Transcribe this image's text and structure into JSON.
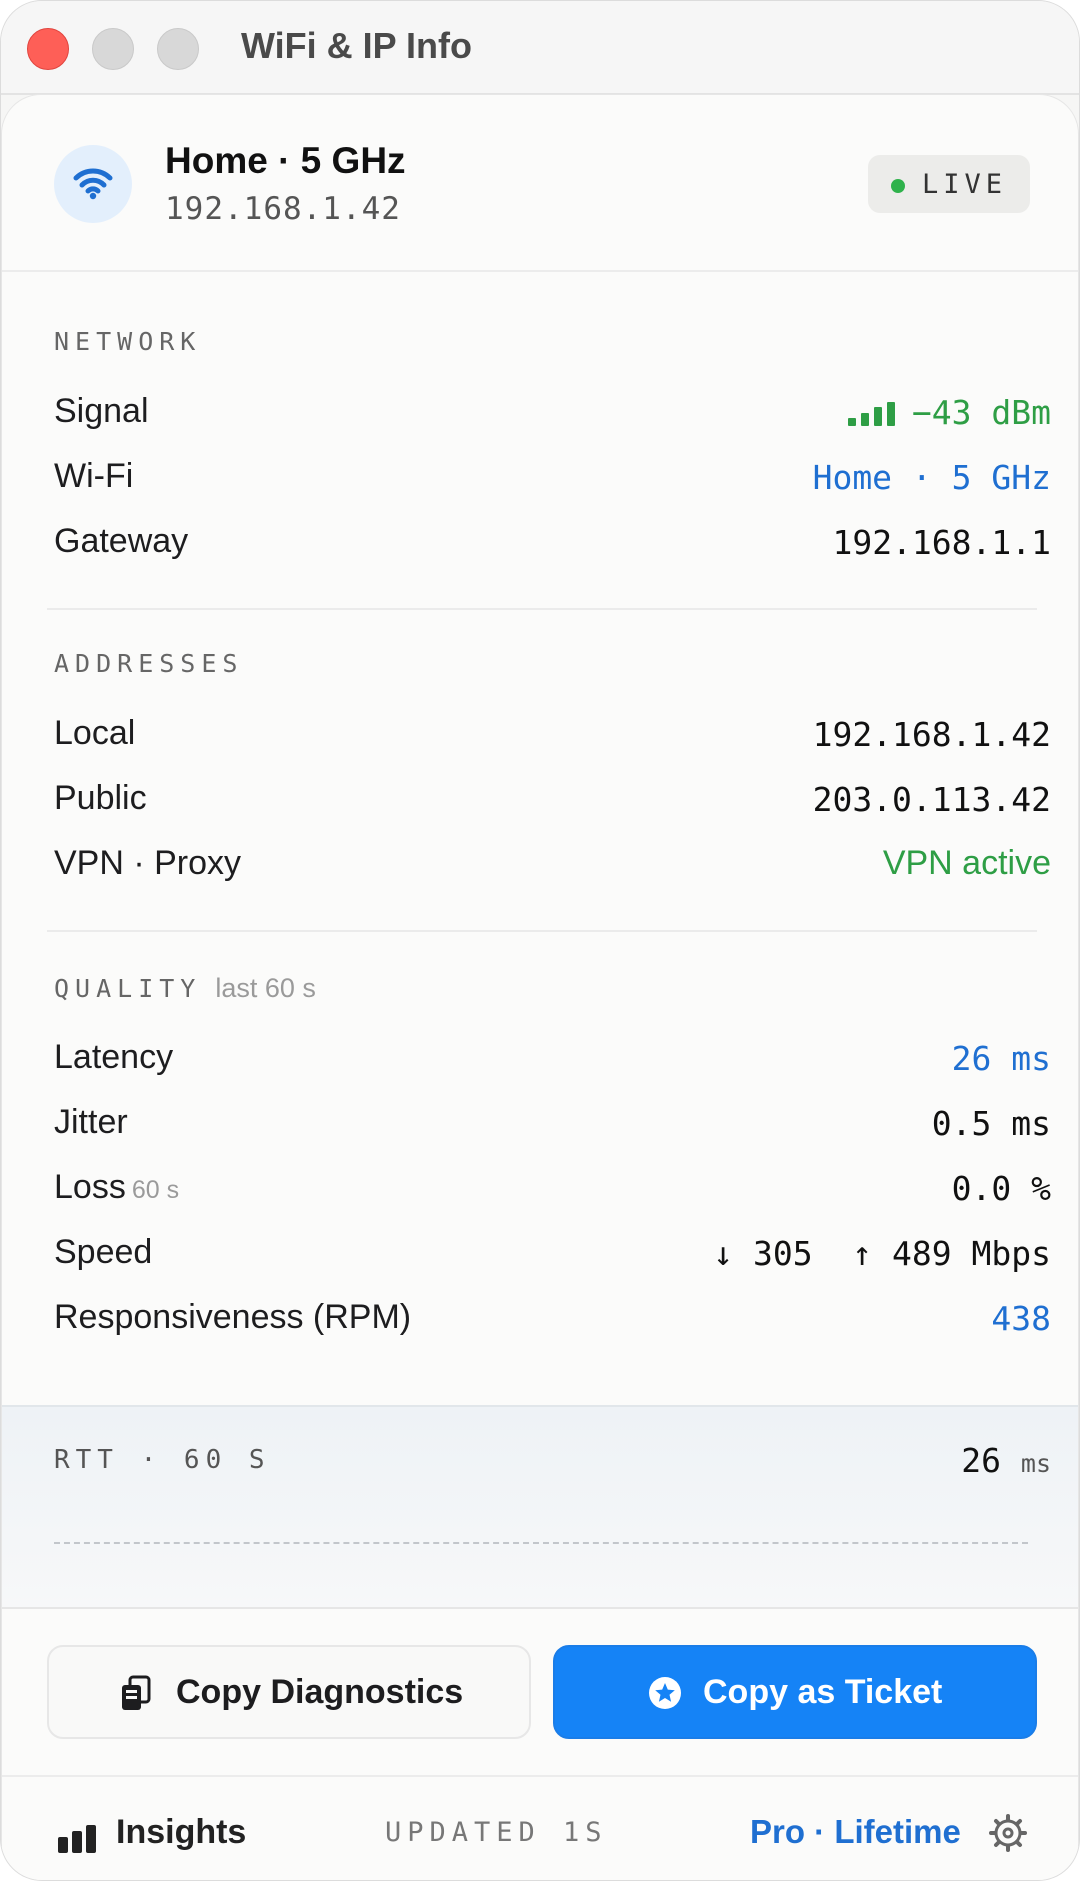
{
  "window": {
    "title": "WiFi & IP Info"
  },
  "header": {
    "network_name": "Home · 5 GHz",
    "ip": "192.168.1.42",
    "status": "LIVE",
    "icon": "wifi-icon"
  },
  "network": {
    "section_label": "NETWORK",
    "rows": [
      {
        "label": "Signal",
        "value": "−43 dBm",
        "color": "#2e9e45"
      },
      {
        "label": "Wi-Fi",
        "value": "Home · 5 GHz",
        "color": "#1f6fd1"
      },
      {
        "label": "Gateway",
        "value": "192.168.1.1",
        "color": "#111111"
      }
    ]
  },
  "addresses": {
    "section_label": "ADDRESSES",
    "rows": [
      {
        "label": "Local",
        "value": "192.168.1.42"
      },
      {
        "label": "Public",
        "value": "203.0.113.42"
      },
      {
        "label": "VPN · Proxy",
        "value": "VPN active",
        "color": "#2e9e45"
      }
    ]
  },
  "quality": {
    "section_label": "QUALITY",
    "section_sub": "last 60 s",
    "latency": {
      "label": "Latency",
      "value": "26 ms",
      "color": "#1f6fd1"
    },
    "jitter": {
      "label": "Jitter",
      "value": "0.5 ms"
    },
    "loss": {
      "label": "Loss",
      "sub": "60 s",
      "value": "0.0 %"
    },
    "speed": {
      "label": "Speed",
      "value": "↓ 305  ↑ 489 Mbps"
    },
    "rpm": {
      "label": "Responsiveness (RPM)",
      "value": "438",
      "color": "#1f6fd1"
    }
  },
  "rtt": {
    "label": "RTT · 60 S",
    "value": "26",
    "unit": "ms"
  },
  "buttons": {
    "copy_diagnostics": "Copy Diagnostics",
    "copy_ticket": "Copy as Ticket"
  },
  "footer": {
    "insights": "Insights",
    "updated": "UPDATED 1S",
    "plan": "Pro · Lifetime"
  },
  "colors": {
    "accent": "#1583f6",
    "green": "#2e9e45",
    "blue": "#1f6fd1",
    "close": "#fe5f57"
  }
}
